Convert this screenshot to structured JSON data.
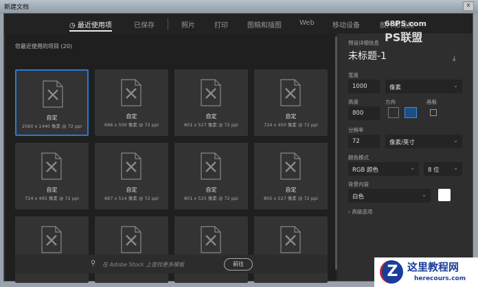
{
  "window": {
    "title": "新建文档",
    "close": "x"
  },
  "tabs": [
    "最近使用项",
    "已保存",
    "照片",
    "打印",
    "图稿和插图",
    "Web",
    "移动设备",
    "胶片和视频"
  ],
  "recent": {
    "heading": "您最近使用的项目",
    "count": "(20)",
    "items": [
      {
        "name": "自定",
        "dims": "2560 x 1440 像素 @ 72 ppi"
      },
      {
        "name": "自定",
        "dims": "696 x 500 像素 @ 72 ppi"
      },
      {
        "name": "自定",
        "dims": "801 x 527 像素 @ 72 ppi"
      },
      {
        "name": "自定",
        "dims": "724 x 450 像素 @ 72 ppi"
      },
      {
        "name": "自定",
        "dims": "724 x 495 像素 @ 72 ppi"
      },
      {
        "name": "自定",
        "dims": "687 x 514 像素 @ 72 ppi"
      },
      {
        "name": "自定",
        "dims": "801 x 525 像素 @ 72 ppi"
      },
      {
        "name": "自定",
        "dims": "805 x 527 像素 @ 72 ppi"
      },
      {
        "name": "",
        "dims": ""
      },
      {
        "name": "",
        "dims": ""
      },
      {
        "name": "",
        "dims": ""
      },
      {
        "name": "",
        "dims": ""
      }
    ]
  },
  "stock": {
    "placeholder": "在 Adobe Stock 上查找更多模板",
    "go": "前往"
  },
  "preset": {
    "heading": "预设详细信息",
    "doc_name": "未标题-1",
    "width_label": "宽度",
    "width": "1000",
    "width_unit": "像素",
    "height_label": "高度",
    "height": "800",
    "orientation_label": "方向",
    "artboard_label": "画板",
    "resolution_label": "分辨率",
    "resolution": "72",
    "resolution_unit": "像素/英寸",
    "color_mode_label": "颜色模式",
    "color_mode": "RGB 颜色",
    "bit_depth": "8 位",
    "bg_label": "背景内容",
    "bg": "白色",
    "bg_color": "#ffffff",
    "advanced": "高级选项"
  },
  "watermarks": {
    "top_site": "68PS.com",
    "top_brand": "PS联盟",
    "bottom_brand": "这里教程网",
    "bottom_site": "herecours.com"
  }
}
